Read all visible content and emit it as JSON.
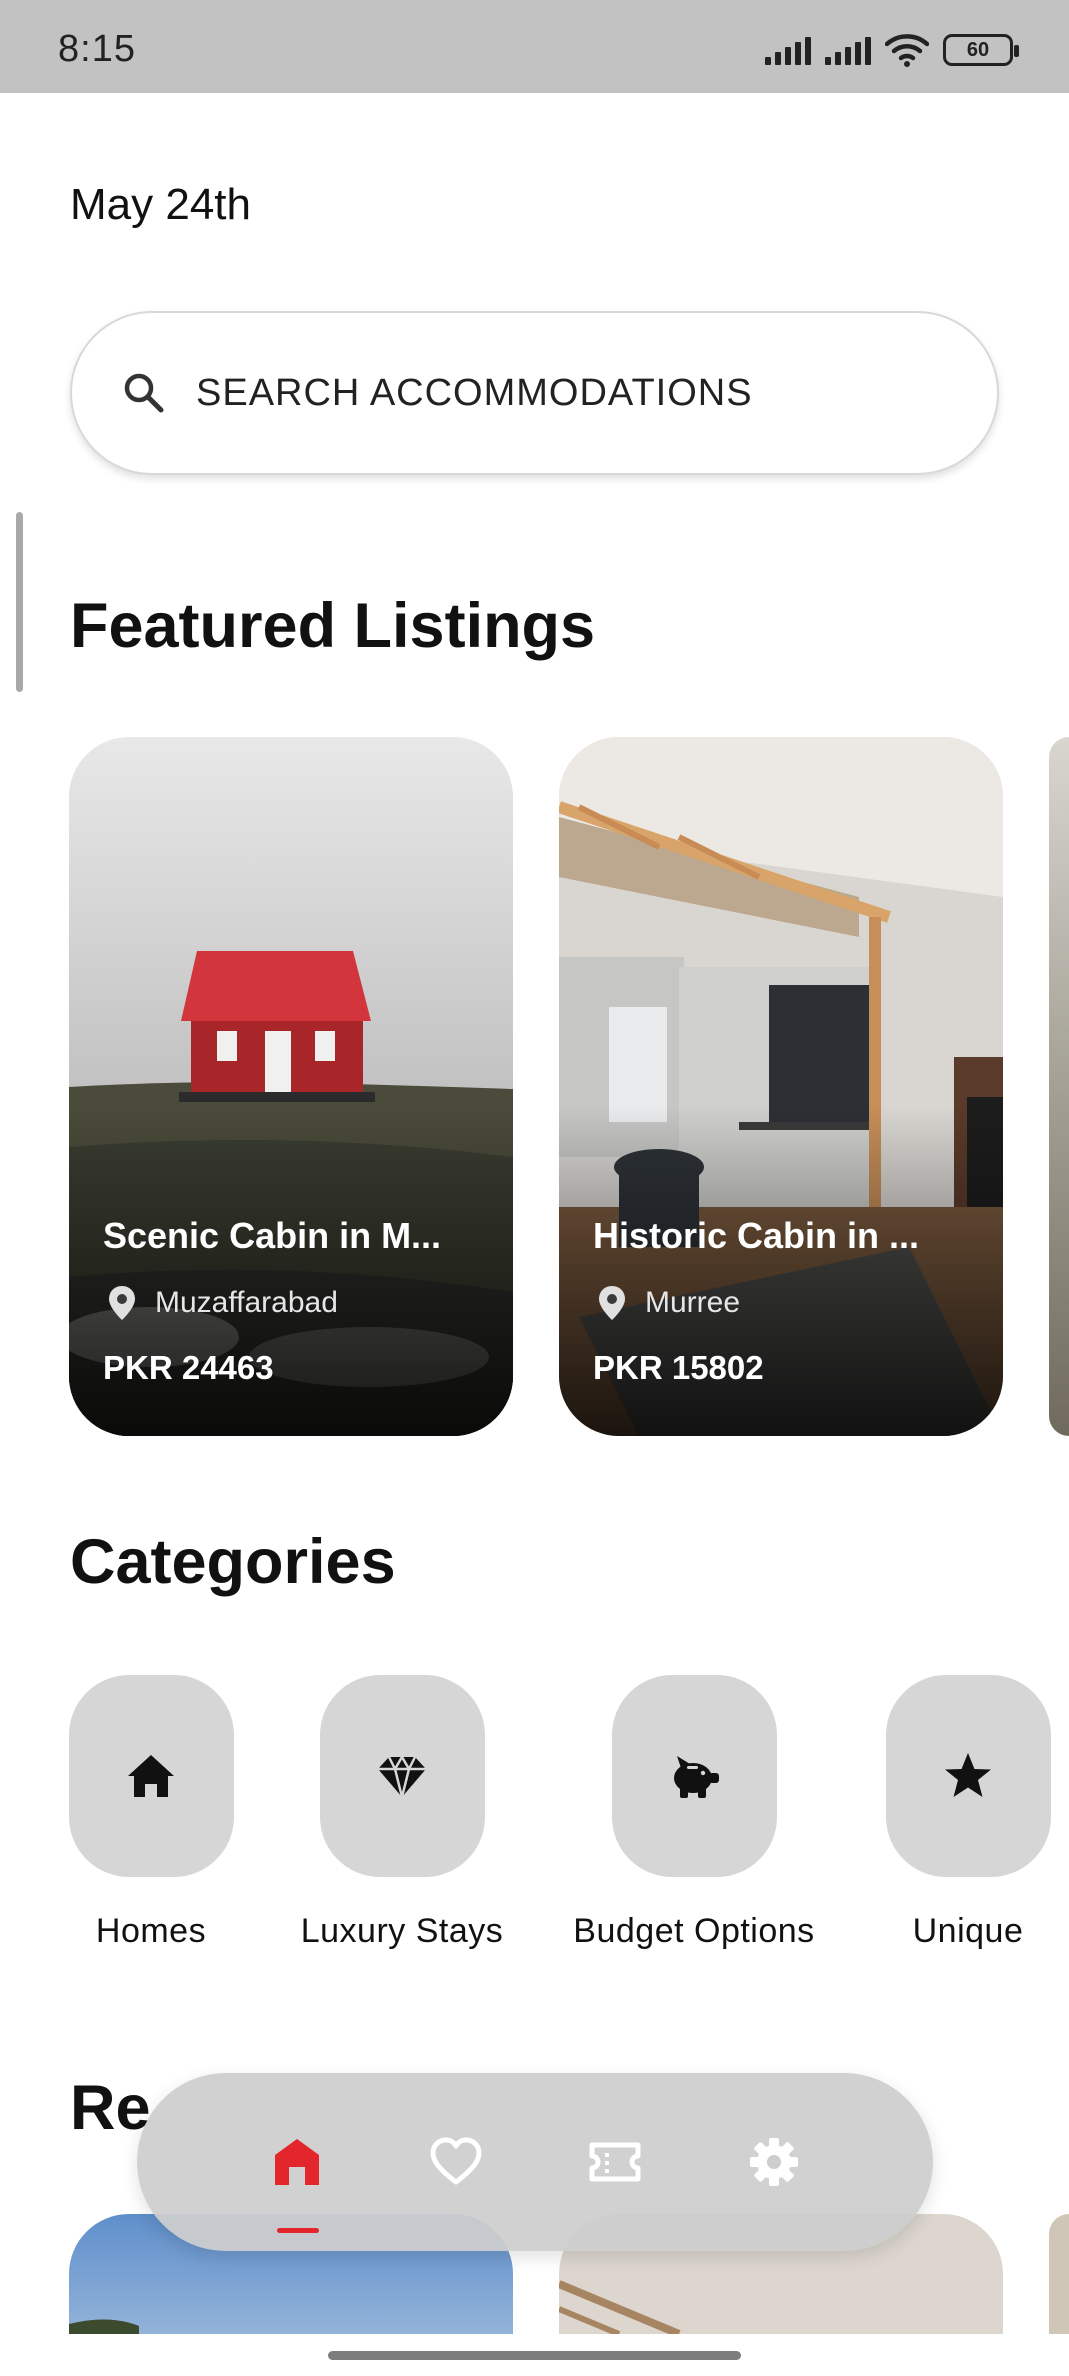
{
  "status_bar": {
    "time": "8:15",
    "battery": "60"
  },
  "header": {
    "date": "May 24th"
  },
  "search": {
    "placeholder": "SEARCH ACCOMMODATIONS"
  },
  "featured": {
    "title": "Featured Listings",
    "listings": [
      {
        "title": "Scenic Cabin in M...",
        "location": "Muzaffarabad",
        "price": "PKR 24463"
      },
      {
        "title": "Historic Cabin in ...",
        "location": "Murree",
        "price": "PKR 15802"
      }
    ]
  },
  "categories": {
    "title": "Categories",
    "items": [
      {
        "label": "Homes",
        "icon": "home-icon"
      },
      {
        "label": "Luxury Stays",
        "icon": "diamond-icon"
      },
      {
        "label": "Budget Options",
        "icon": "piggy-bank-icon"
      },
      {
        "label": "Unique",
        "icon": "star-icon"
      }
    ]
  },
  "recommended": {
    "title": "Re"
  },
  "bottom_nav": {
    "items": [
      {
        "icon": "home-icon",
        "active": true
      },
      {
        "icon": "heart-icon",
        "active": false
      },
      {
        "icon": "ticket-icon",
        "active": false
      },
      {
        "icon": "gear-icon",
        "active": false
      }
    ]
  },
  "colors": {
    "accent": "#e3262b",
    "tile_bg": "#d6d6d6",
    "status_bar": "#c2c2c2"
  }
}
